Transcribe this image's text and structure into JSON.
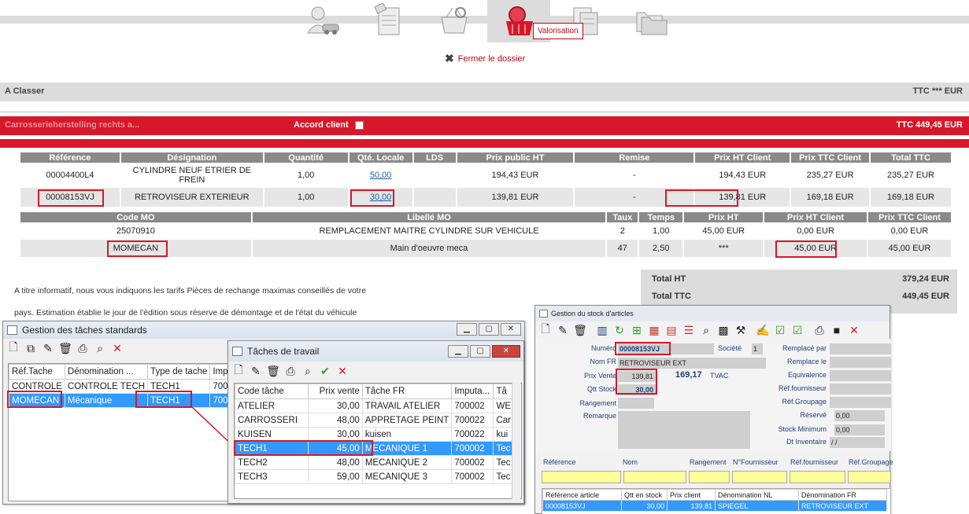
{
  "nav": {
    "tooltip": "Valorisation",
    "close_label": "Fermer le dossier"
  },
  "classer": {
    "left": "A Classer",
    "right": "TTC  ***   EUR"
  },
  "redbar": {
    "left": "Carrosserieherstelling rechts a...",
    "accord": "Accord client",
    "right": "TTC 449,45  EUR"
  },
  "parts": {
    "headers": [
      "Référence",
      "Désignation",
      "Quantité",
      "Qté. Locale",
      "LDS",
      "Prix public HT",
      "Remise",
      "Prix HT Client",
      "Prix TTC Client",
      "Total TTC"
    ],
    "rows": [
      [
        "00004400L4",
        "CYLINDRE NEUF ETRIER DE FREIN",
        "1,00",
        "50,00",
        "",
        "194,43 EUR",
        "-",
        "194,43 EUR",
        "235,27 EUR",
        "235,27 EUR"
      ],
      [
        "00008153VJ",
        "RETROVISEUR EXTERIEUR",
        "1,00",
        "30,00",
        "",
        "139,81 EUR",
        "-",
        "139,81 EUR",
        "169,18 EUR",
        "169,18 EUR"
      ]
    ]
  },
  "labor": {
    "headers": [
      "Code MO",
      "Libellé MO",
      "Taux",
      "Temps",
      "Prix HT",
      "Prix HT Client",
      "Prix TTC Client"
    ],
    "rows": [
      [
        "25070910",
        "REMPLACEMENT MAITRE CYLINDRE SUR VEHICULE",
        "2",
        "1,00",
        "45,00 EUR",
        "0,00 EUR",
        "0,00 EUR"
      ],
      [
        "MOMECAN",
        "Main d'oeuvre meca",
        "47",
        "2,50",
        "***",
        "45,00 EUR",
        "45,00 EUR"
      ]
    ]
  },
  "info": {
    "line1": "A titre informatif, nous vous indiquons les tarifs Pièces de rechange maximas conseillés  de  votre",
    "line2": "pays. Estimation établie le jour de l'édition sous réserve de démontage et de l'état du véhicule"
  },
  "totals": {
    "ht_label": "Total HT",
    "ht_value": "379,24  EUR",
    "ttc_label": "Total TTC",
    "ttc_value": "449,45  EUR"
  },
  "win_taches_std": {
    "title": "Gestion des tâches standards",
    "headers": [
      "Réf.Tache",
      "Dénomination ...",
      "Type de tache",
      "Impu"
    ],
    "rows": [
      [
        "CONTROLE",
        "CONTROLE TECH",
        "TECH1",
        "7000"
      ],
      [
        "MOMECAN",
        "Mécanique",
        "TECH1",
        "7000"
      ]
    ]
  },
  "win_taches_travail": {
    "title": "Tâches de travail",
    "headers": [
      "Code tâche",
      "Prix vente",
      "Tâche FR",
      "Imputa...",
      "Tâ"
    ],
    "rows": [
      [
        "ATELIER",
        "30,00",
        "TRAVAIL ATELIER",
        "700002",
        "WE"
      ],
      [
        "CARROSSERI",
        "48,00",
        "APPRETAGE PEINT",
        "700022",
        "Car"
      ],
      [
        "KUISEN",
        "30,00",
        "kuisen",
        "700022",
        "kui"
      ],
      [
        "TECH1",
        "45,00",
        "MECANIQUE 1",
        "700002",
        "Tec"
      ],
      [
        "TECH2",
        "48,00",
        "MECANIQUE 2",
        "700002",
        "Tec"
      ],
      [
        "TECH3",
        "59,00",
        "MECANIQUE 3",
        "700002",
        "Tec"
      ]
    ]
  },
  "win_stock": {
    "title": "Gestion du stock d'articles",
    "numero_label": "Numéro",
    "numero": "00008153VJ",
    "societe_label": "Société",
    "societe": "1",
    "nomfr_label": "Nom FR",
    "nomfr": "RETROVISEUR EXT",
    "prixvente_label": "Prix Vente",
    "prixvente": "139,81",
    "tvac_value": "169,17",
    "tvac_label": "TVAC",
    "qttstock_label": "Qtt Stock",
    "qttstock": "30,00",
    "rangement_label": "Rangement",
    "remarque_label": "Remarque",
    "right_labels": [
      "Remplacé par",
      "Remplace le",
      "Equivalence",
      "Réf.fournisseur",
      "Réf.Groupage"
    ],
    "reserve_label": "Réservé",
    "reserve": "0,00",
    "stockmin_label": "Stock Minimum",
    "stockmin": "0,00",
    "dtinv_label": "Dt Inventaire",
    "dtinv": "/ /",
    "search_labels": [
      "Référence",
      "Nom",
      "Rangement",
      "N°Fournisseur",
      "Réf.fournisseur",
      "Réf.Groupage"
    ],
    "grid_headers": [
      "Référence article",
      "Qtt en stock",
      "Prix client",
      "Dénomination NL",
      "Dénomination FR"
    ],
    "grid_row": [
      "00008153VJ",
      "30,00",
      "139,81",
      "SPIEGEL",
      "RETROVISEUR EXT"
    ]
  },
  "icons": {
    "nav": [
      "person-car-icon",
      "document-tag-icon",
      "basket-refresh-icon",
      "basket-search-icon",
      "documents-icon",
      "folders-icon"
    ]
  }
}
